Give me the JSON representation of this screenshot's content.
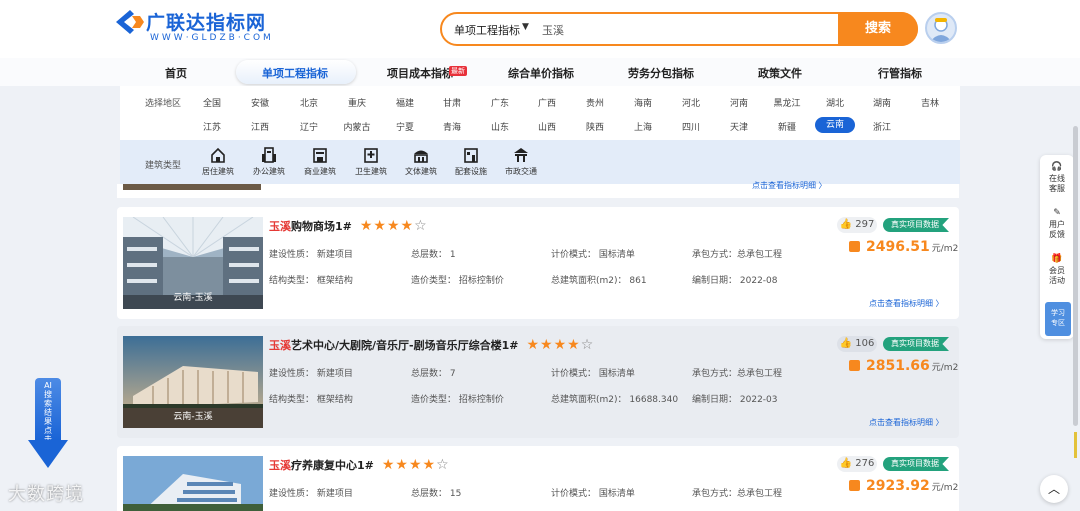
{
  "brand": {
    "name": "广联达指标网",
    "sub": "WWW·GLDZB·COM"
  },
  "search": {
    "category": "单项工程指标",
    "caret": "▼",
    "value": "玉溪",
    "button": "搜索"
  },
  "nav": {
    "items": [
      "首页",
      "单项工程指标",
      "项目成本指标",
      "综合单价指标",
      "劳务分包指标",
      "政策文件",
      "行管指标"
    ],
    "new_badge": "最新",
    "active": "单项工程指标"
  },
  "filters": {
    "region_label": "选择地区",
    "regions_row1": [
      "全国",
      "安徽",
      "北京",
      "重庆",
      "福建",
      "甘肃",
      "广东",
      "广西",
      "贵州",
      "海南",
      "河北",
      "河南",
      "黑龙江",
      "湖北",
      "湖南",
      "吉林"
    ],
    "regions_row2": [
      "江苏",
      "江西",
      "辽宁",
      "内蒙古",
      "宁夏",
      "青海",
      "山东",
      "山西",
      "陕西",
      "上海",
      "四川",
      "天津",
      "新疆",
      "云南",
      "浙江"
    ],
    "active_region": "云南",
    "type_label": "建筑类型",
    "building_types": [
      "居住建筑",
      "办公建筑",
      "商业建筑",
      "卫生建筑",
      "文体建筑",
      "配套设施",
      "市政交通"
    ]
  },
  "field_labels": {
    "nature": "建设性质：",
    "floors": "总层数：",
    "pricing_mode": "计价模式：",
    "contract": "承包方式：",
    "structure": "结构类型：",
    "cost_type": "造价类型：",
    "area": "总建筑面积(m2)：",
    "date": "编制日期："
  },
  "cards": [
    {
      "keyword": "玉溪",
      "title": "购物商场1#",
      "stars": "★★★★",
      "star_empty": "☆",
      "nature": "新建项目",
      "floors": "1",
      "pricing_mode": "国标清单",
      "contract": "总承包工程",
      "structure": "框架结构",
      "cost_type": "招标控制价",
      "area": "861",
      "date": "2022-08",
      "likes": "297",
      "verified": "真实项目数据",
      "price": "2496.51",
      "unit": "元/m2",
      "photo_tag": "云南-玉溪",
      "detail": "点击查看指标明细 〉"
    },
    {
      "keyword": "玉溪",
      "title": "艺术中心/大剧院/音乐厅-剧场音乐厅综合楼1#",
      "stars": "★★★★",
      "star_empty": "☆",
      "nature": "新建项目",
      "floors": "7",
      "pricing_mode": "国标清单",
      "contract": "总承包工程",
      "structure": "框架结构",
      "cost_type": "招标控制价",
      "area": "16688.340",
      "date": "2022-03",
      "likes": "106",
      "verified": "真实项目数据",
      "price": "2851.66",
      "unit": "元/m2",
      "photo_tag": "云南-玉溪",
      "detail": "点击查看指标明细 〉"
    },
    {
      "keyword": "玉溪",
      "title": "疗养康复中心1#",
      "stars": "★★★★",
      "star_empty": "☆",
      "nature": "新建项目",
      "floors": "15",
      "pricing_mode": "国标清单",
      "contract": "总承包工程",
      "likes": "276",
      "verified": "真实项目数据",
      "price": "2923.92",
      "unit": "元/m2"
    }
  ],
  "peek_link": "点击查看指标明细 〉",
  "side_float": {
    "items": [
      "在线客服",
      "用户反馈",
      "会员活动"
    ],
    "study": "学习专区"
  },
  "ai_button": "AI搜索结果点击查看",
  "watermark": "大数跨境",
  "to_top": "︿",
  "colors": {
    "primary": "#1a64d6",
    "accent": "#f7881e",
    "verified": "#23a27d",
    "keyword": "#e53935"
  }
}
